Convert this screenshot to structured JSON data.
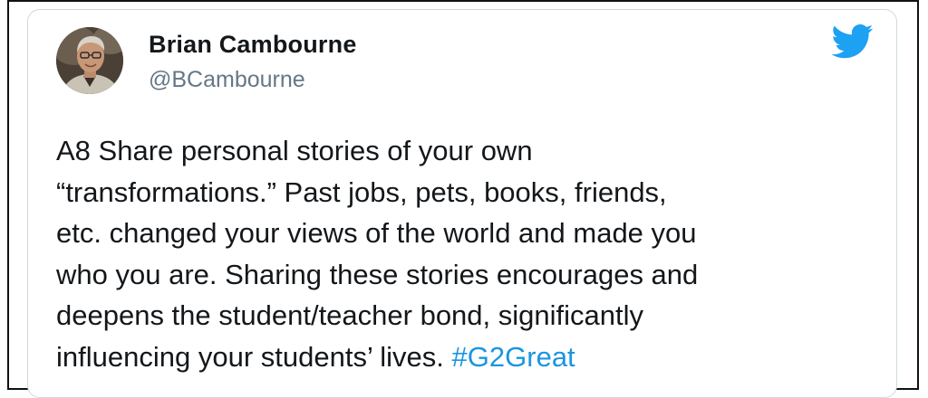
{
  "tweet": {
    "author_name": "Brian Cambourne",
    "author_handle": "@BCambourne",
    "icon": "twitter-bird-icon",
    "brand_color": "#1da1f2",
    "hashtag_color": "#1b95e0",
    "text_lines": [
      "A8 Share personal stories of your own",
      "“transformations.” Past jobs, pets, books, friends,",
      "etc. changed your views of the world and made you",
      "who you are. Sharing these stories encourages and",
      "deepens the student/teacher bond, significantly",
      "influencing your students’ lives."
    ],
    "hashtag": "#G2Great"
  }
}
